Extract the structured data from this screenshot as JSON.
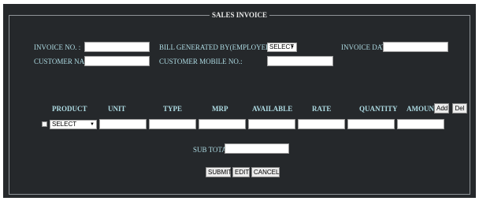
{
  "form": {
    "title": "SALES INVOICE",
    "fields": {
      "invoice_no": {
        "label": "INVOICE NO. :",
        "value": ""
      },
      "bill_generated_by": {
        "label": "BILL GENERATED BY(EMPLOYEE NAME):",
        "selected": "SELECT"
      },
      "invoice_date": {
        "label": "INVOICE DATE:",
        "value": ""
      },
      "customer_name": {
        "label": "CUSTOMER NAME:",
        "value": ""
      },
      "customer_mobile": {
        "label": "CUSTOMER MOBILE NO.:",
        "value": ""
      }
    }
  },
  "table": {
    "headers": [
      "PRODUCT",
      "UNIT",
      "TYPE",
      "MRP",
      "AVAILABLE",
      "RATE",
      "QUANTITY",
      "AMOUNT"
    ],
    "add_label": "Add",
    "del_label": "Del",
    "row": {
      "product_selected": "SELECT",
      "unit": "",
      "type": "",
      "mrp": "",
      "available": "",
      "rate": "",
      "quantity": "",
      "amount": ""
    }
  },
  "totals": {
    "subtotal_label": "SUB TOTAL:",
    "subtotal_value": ""
  },
  "actions": {
    "submit_label": "SUBMIT",
    "edit_label": "EDIT",
    "cancel_label": "CANCEL"
  },
  "colors": {
    "panel_background": "#25282b",
    "label_text": "#aedbe3",
    "fieldset_border": "#8f9498"
  }
}
